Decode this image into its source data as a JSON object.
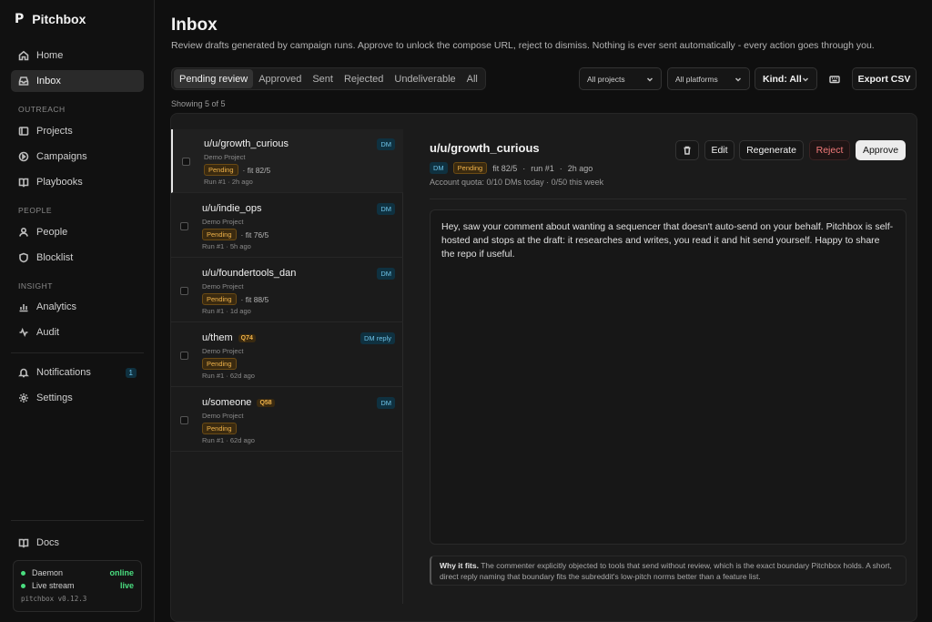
{
  "app": {
    "name": "Pitchbox",
    "logo": "P",
    "version": "pitchbox v0.12.3"
  },
  "sidebar": {
    "main": [
      {
        "label": "Home",
        "icon": "home-icon"
      },
      {
        "label": "Inbox",
        "icon": "inbox-icon",
        "active": true
      }
    ],
    "sections": [
      {
        "label": "OUTREACH",
        "items": [
          {
            "label": "Projects",
            "icon": "folder-icon"
          },
          {
            "label": "Campaigns",
            "icon": "target-icon"
          },
          {
            "label": "Playbooks",
            "icon": "book-icon"
          }
        ]
      },
      {
        "label": "PEOPLE",
        "items": [
          {
            "label": "People",
            "icon": "person-icon"
          },
          {
            "label": "Blocklist",
            "icon": "ban-icon"
          }
        ]
      },
      {
        "label": "INSIGHT",
        "items": [
          {
            "label": "Analytics",
            "icon": "chart-icon"
          },
          {
            "label": "Audit",
            "icon": "magnifier-icon"
          }
        ]
      }
    ],
    "notifications": {
      "label": "Notifications",
      "count": "1"
    },
    "settings": {
      "label": "Settings"
    },
    "docs": {
      "label": "Docs"
    },
    "status": [
      {
        "label": "Daemon",
        "value": "online"
      },
      {
        "label": "Live stream",
        "value": "live"
      }
    ]
  },
  "header": {
    "title": "Inbox",
    "description": "Review drafts generated by campaign runs. Approve to unlock the compose URL, reject to dismiss. Nothing is ever sent automatically - every action goes through you."
  },
  "tabs": [
    "Pending review",
    "Approved",
    "Sent",
    "Rejected",
    "Undeliverable",
    "All"
  ],
  "filters": {
    "project": "All projects",
    "platform": "All platforms",
    "kind": "Kind: All",
    "export": "Export CSV"
  },
  "showing": "Showing 5 of 5",
  "items": [
    {
      "user": "u/u/growth_curious",
      "project": "Demo Project",
      "status": "Pending",
      "fit": "· fit 82/5",
      "run": "Run #1 · 2h ago",
      "kind": "DM",
      "q": ""
    },
    {
      "user": "u/u/indie_ops",
      "project": "Demo Project",
      "status": "Pending",
      "fit": "· fit 76/5",
      "run": "Run #1 · 5h ago",
      "kind": "DM",
      "q": ""
    },
    {
      "user": "u/u/foundertools_dan",
      "project": "Demo Project",
      "status": "Pending",
      "fit": "· fit 88/5",
      "run": "Run #1 · 1d ago",
      "kind": "DM",
      "q": ""
    },
    {
      "user": "u/them",
      "project": "Demo Project",
      "status": "Pending",
      "fit": "",
      "run": "Run #1 · 62d ago",
      "kind": "DM reply",
      "q": "Q74"
    },
    {
      "user": "u/someone",
      "project": "Demo Project",
      "status": "Pending",
      "fit": "",
      "run": "Run #1 · 62d ago",
      "kind": "DM",
      "q": "Q58"
    }
  ],
  "detail": {
    "user": "u/u/growth_curious",
    "kind": "DM",
    "status": "Pending",
    "fit": "fit 82/5",
    "run": "run #1",
    "age": "2h ago",
    "quota": "Account quota: 0/10 DMs today · 0/50 this week",
    "actions": {
      "edit": "Edit",
      "regenerate": "Regenerate",
      "reject": "Reject",
      "approve": "Approve"
    },
    "draft": "Hey, saw your comment about wanting a sequencer that doesn't auto-send on your behalf. Pitchbox is self-hosted and stops at the draft: it researches and writes, you read it and hit send yourself. Happy to share the repo if useful.",
    "why_label": "Why it fits.",
    "why_text": "The commenter explicitly objected to tools that send without review, which is the exact boundary Pitchbox holds. A short, direct reply naming that boundary fits the subreddit's low-pitch norms better than a feature list."
  }
}
